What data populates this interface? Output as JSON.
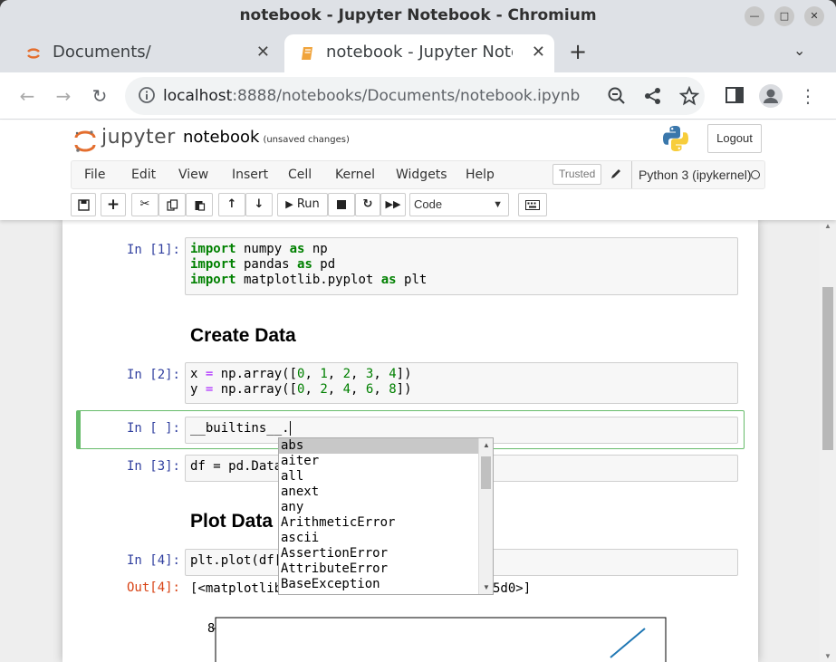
{
  "window": {
    "title": "notebook - Jupyter Notebook - Chromium",
    "minimize": "—",
    "maximize": "□",
    "close": "✕"
  },
  "tabs": [
    {
      "label": "Documents/",
      "close": "✕"
    },
    {
      "label": "notebook - Jupyter Notebook",
      "close": "✕"
    }
  ],
  "browser": {
    "new_tab": "+",
    "tab_menu": "⌄",
    "back": "←",
    "forward": "→",
    "reload": "↻",
    "url_host": "localhost",
    "url_rest": ":8888/notebooks/Documents/notebook.ipynb",
    "menu_dots": "⋮"
  },
  "jupyter": {
    "wordmark": "jupyter",
    "notebook_name": "notebook",
    "unsaved": "(unsaved changes)",
    "logout": "Logout",
    "menu": [
      "File",
      "Edit",
      "View",
      "Insert",
      "Cell",
      "Kernel",
      "Widgets",
      "Help"
    ],
    "trusted": "Trusted",
    "kernel": "Python 3 (ipykernel)",
    "toolbar": {
      "run": "Run",
      "cell_type": "Code"
    }
  },
  "cells": {
    "c1_prompt": "In [1]:",
    "c2_heading": "Create Data",
    "c2_prompt": "In [2]:",
    "c3_prompt": "In [ ]:",
    "c3_code": "__builtins__.",
    "c4_prompt": "In [3]:",
    "c4_code": "df = pd.Data",
    "c5_heading": "Plot Data",
    "c6_prompt": "In [4]:",
    "c6_code": "plt.plot(df[",
    "c6_out_prompt": "Out[4]:",
    "c6_out_text": "[<matplotlib",
    "c6_out_tail": "5d0>]",
    "plot_ytick": "8"
  },
  "completions": [
    "abs",
    "aiter",
    "all",
    "anext",
    "any",
    "ArithmeticError",
    "ascii",
    "AssertionError",
    "AttributeError",
    "BaseException"
  ],
  "colors": {
    "accent_green": "#66bb6a",
    "prompt_in": "#303f9f",
    "prompt_out": "#d84315",
    "keyword": "#008000"
  }
}
